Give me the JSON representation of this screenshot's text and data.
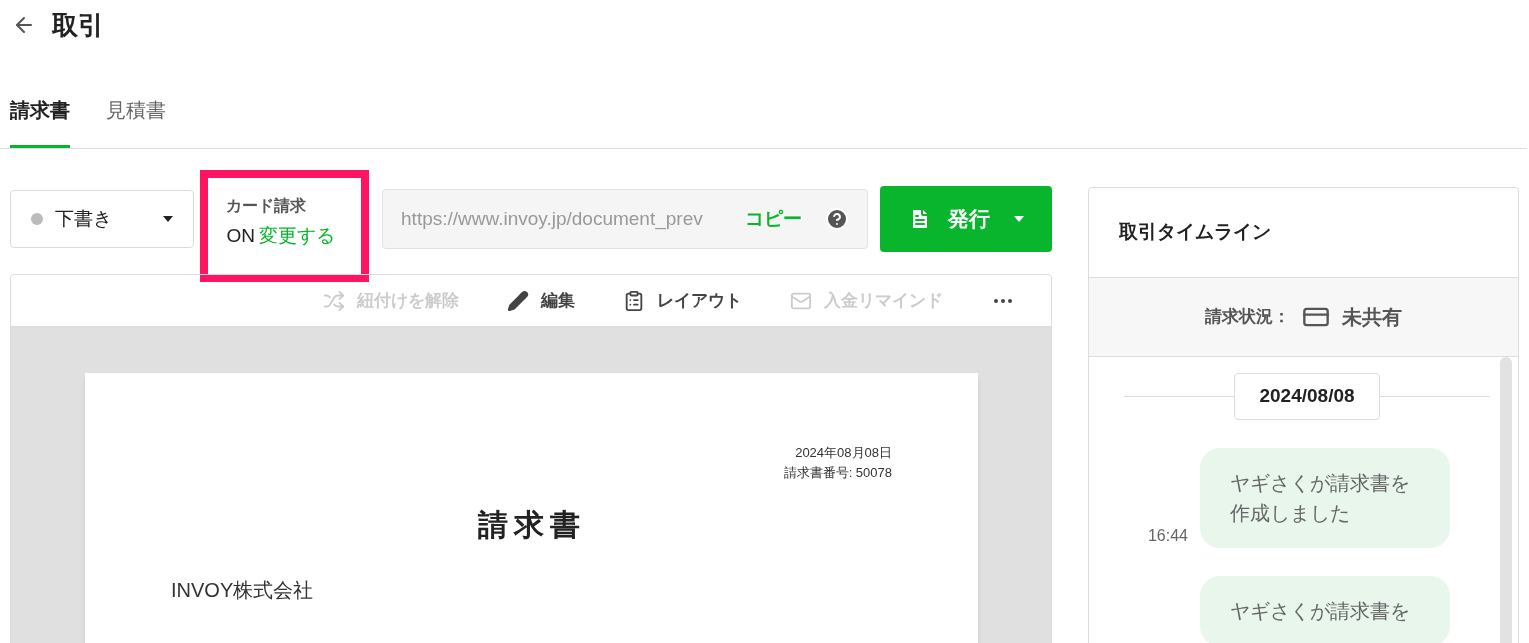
{
  "header": {
    "title": "取引"
  },
  "tabs": [
    {
      "label": "請求書",
      "selected": true
    },
    {
      "label": "見積書",
      "selected": false
    }
  ],
  "status_dropdown": {
    "value": "下書き"
  },
  "card_billing": {
    "label": "カード請求",
    "state": "ON",
    "link": "変更する",
    "highlighted": true
  },
  "share_url": {
    "value": "https://www.invoy.jp/document_prev",
    "copy": "コピー"
  },
  "issue_button": {
    "label": "発行"
  },
  "toolbar": [
    {
      "kind": "unlink",
      "label": "紐付けを解除",
      "disabled": true
    },
    {
      "kind": "edit",
      "label": "編集",
      "disabled": false
    },
    {
      "kind": "layout",
      "label": "レイアウト",
      "disabled": false
    },
    {
      "kind": "remind",
      "label": "入金リマインド",
      "disabled": true
    },
    {
      "kind": "more"
    }
  ],
  "document": {
    "date": "2024年08月08日",
    "number": "請求書番号: 50078",
    "title": "請求書",
    "company": "INVOY株式会社"
  },
  "timeline": {
    "title": "取引タイムライン",
    "status_label": "請求状況：",
    "status": "未共有",
    "date": "2024/08/08",
    "entries": [
      {
        "time": "16:44",
        "text": "ヤギさくが請求書を作成しました"
      },
      {
        "text": "ヤギさくが請求書を"
      }
    ]
  }
}
